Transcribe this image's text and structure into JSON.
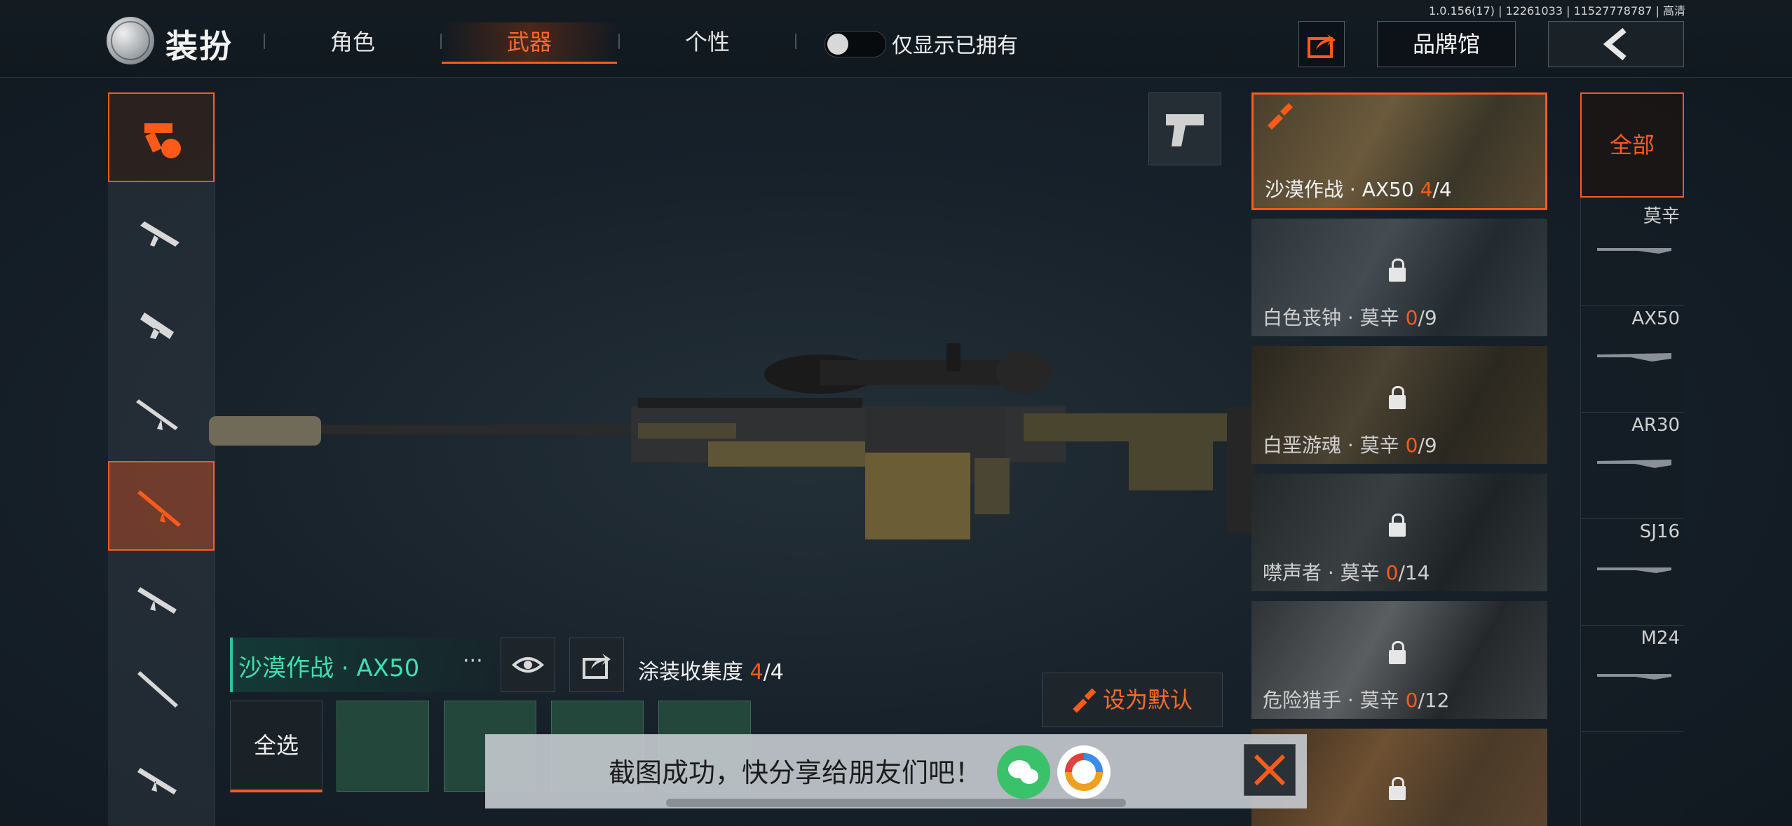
{
  "version_info": "1.0.156(17) | 12261033 | 11527778787 | 高清",
  "header": {
    "title": "装扮",
    "tabs": [
      {
        "label": "角色"
      },
      {
        "label": "武器"
      },
      {
        "label": "个性"
      }
    ],
    "active_tab": "武器",
    "owned_toggle_label": "仅显示已拥有",
    "owned_toggle_on": false,
    "brand_label": "品牌馆"
  },
  "categories": [
    {
      "icon": "weapon-all-icon",
      "active": true
    },
    {
      "icon": "assault-rifle-icon"
    },
    {
      "icon": "smg-icon"
    },
    {
      "icon": "rifle-icon"
    },
    {
      "icon": "sniper-icon",
      "selected": true
    },
    {
      "icon": "carbine-icon"
    },
    {
      "icon": "shotgun-icon"
    },
    {
      "icon": "lmg-icon"
    }
  ],
  "skins": [
    {
      "name": "沙漠作战 · AX50",
      "owned": "4",
      "total": "/4",
      "active": true
    },
    {
      "name": "白色丧钟 · 莫辛",
      "owned": "0",
      "total": "/9",
      "locked": true
    },
    {
      "name": "白垩游魂 · 莫辛",
      "owned": "0",
      "total": "/9",
      "locked": true
    },
    {
      "name": "噤声者 · 莫辛",
      "owned": "0",
      "total": "/14",
      "locked": true
    },
    {
      "name": "危险猎手 · 莫辛",
      "owned": "0",
      "total": "/12",
      "locked": true
    }
  ],
  "filters": {
    "all_label": "全部",
    "weapons": [
      "莫辛",
      "AX50",
      "AR30",
      "SJ16",
      "M24"
    ]
  },
  "detail": {
    "skin_name": "沙漠作战 · AX50",
    "more_label": "···",
    "collection_label": "涂装收集度",
    "collection_current": "4",
    "collection_total": "/4",
    "set_default_label": "设为默认",
    "select_all_label": "全选"
  },
  "toast": {
    "message": "截图成功，快分享给朋友们吧！"
  },
  "colors": {
    "accent": "#ff5a1a",
    "teal": "#3fe0b2"
  }
}
